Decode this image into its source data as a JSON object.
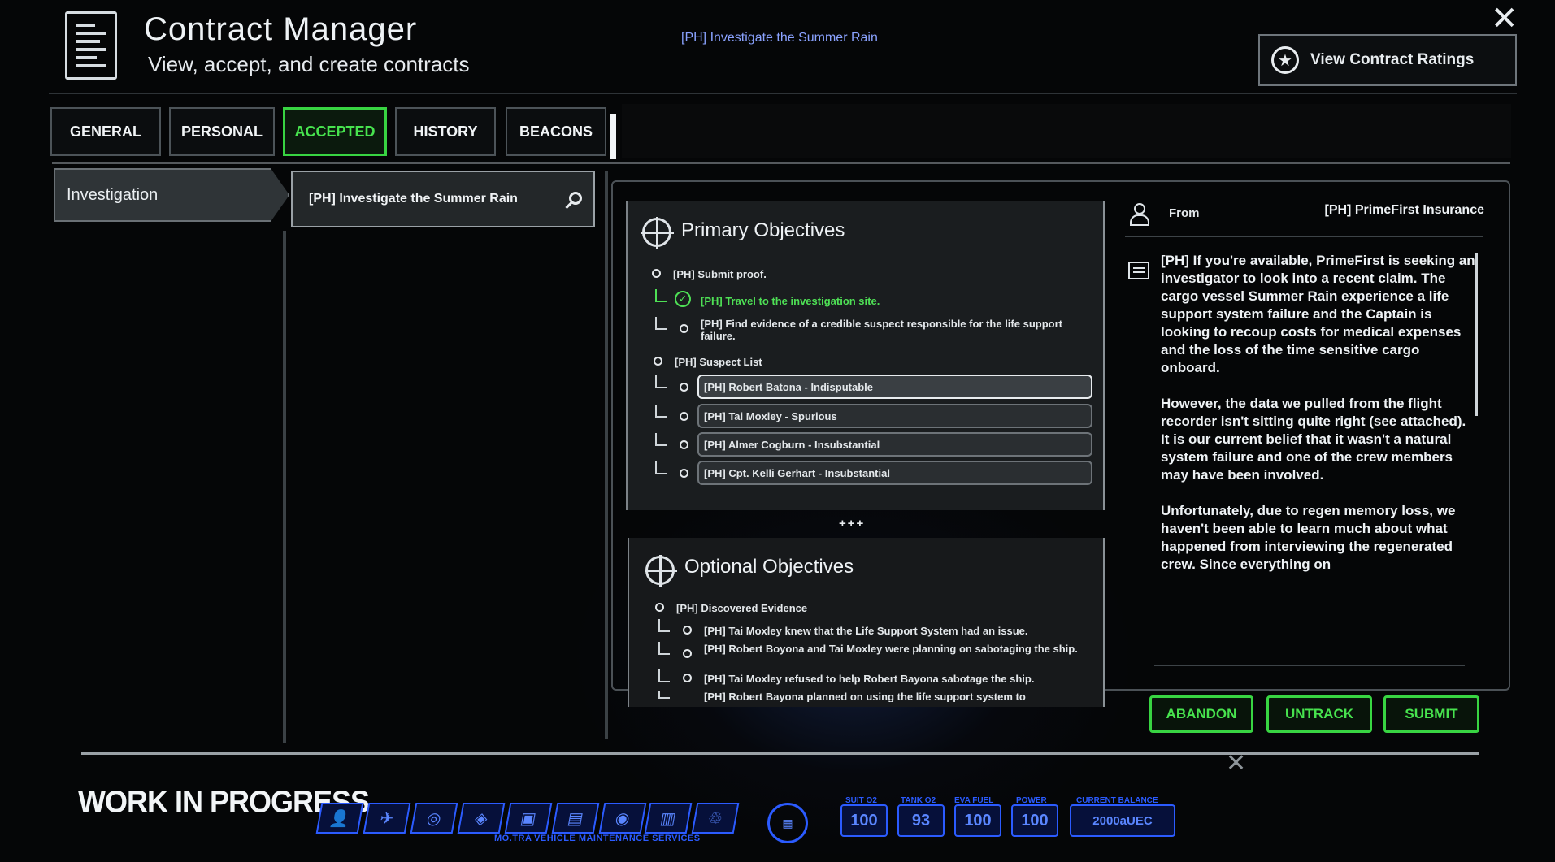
{
  "header": {
    "title": "Contract Manager",
    "subtitle": "View, accept, and create contracts",
    "tracked_contract": "[PH] Investigate the Summer Rain",
    "ratings_button": "View Contract Ratings"
  },
  "tabs": [
    {
      "label": "GENERAL",
      "active": false
    },
    {
      "label": "PERSONAL",
      "active": false
    },
    {
      "label": "ACCEPTED",
      "active": true
    },
    {
      "label": "HISTORY",
      "active": false
    },
    {
      "label": "BEACONS",
      "active": false
    }
  ],
  "categories": [
    {
      "label": "Investigation"
    }
  ],
  "contracts": [
    {
      "label": "[PH] Investigate the Summer Rain"
    }
  ],
  "primary": {
    "title": "Primary Objectives",
    "objectives": [
      {
        "text": "[PH] Submit proof.",
        "level": 0,
        "done": false
      },
      {
        "text": "[PH] Travel to the investigation site.",
        "level": 1,
        "done": true
      },
      {
        "text": "[PH] Find evidence of a credible suspect responsible for the life support failure.",
        "level": 1,
        "done": false
      },
      {
        "text": "[PH] Suspect List",
        "level": 0,
        "done": false
      }
    ],
    "suspects": [
      {
        "text": "[PH] Robert Batona - Indisputable",
        "selected": true
      },
      {
        "text": "[PH] Tai Moxley - Spurious",
        "selected": false
      },
      {
        "text": "[PH] Almer Cogburn - Insubstantial",
        "selected": false
      },
      {
        "text": "[PH] Cpt. Kelli Gerhart - Insubstantial",
        "selected": false
      }
    ],
    "more": "+++"
  },
  "optional": {
    "title": "Optional Objectives",
    "objectives": [
      {
        "text": "[PH] Discovered Evidence",
        "level": 0
      },
      {
        "text": "[PH] Tai Moxley knew that the Life Support System had an issue.",
        "level": 1
      },
      {
        "text": "[PH] Robert Boyona and Tai Moxley were planning on sabotaging the ship.",
        "level": 1
      },
      {
        "text": "[PH] Tai Moxley refused to help Robert Bayona sabotage the ship.",
        "level": 1
      },
      {
        "text": "[PH] Robert Bayona planned on using the life support system to",
        "level": 1
      }
    ]
  },
  "details": {
    "from_label": "From",
    "from_value": "[PH] PrimeFirst Insurance",
    "description": "[PH] If you're available, PrimeFirst is seeking an investigator to look into a recent claim. The cargo vessel Summer Rain experience a life support system failure and the Captain is looking to recoup costs for medical expenses and the loss of the time sensitive cargo onboard.\n\nHowever, the data we pulled from the flight recorder isn't sitting quite right (see attached). It is our current belief that it wasn't a natural system failure and one of the crew members may have been involved.\n\nUnfortunately, due to regen memory loss, we haven't been able to learn much about what happened from interviewing the regenerated crew. Since everything on"
  },
  "actions": {
    "abandon": "ABANDON",
    "untrack": "UNTRACK",
    "submit": "SUBMIT"
  },
  "footer": {
    "watermark": "WORK IN PROGRESS",
    "hud_label": "MO.TRA VEHICLE MAINTENANCE SERVICES",
    "icons": [
      "person-icon",
      "ship-icon",
      "nn-icon",
      "shield-icon",
      "cube-icon",
      "document-icon",
      "fire-icon",
      "terminal-icon",
      "recycle-icon"
    ],
    "stats": [
      {
        "label": "SUIT O2",
        "value": "100"
      },
      {
        "label": "TANK O2",
        "value": "93"
      },
      {
        "label": "EVA FUEL",
        "value": "100"
      },
      {
        "label": "POWER",
        "value": "100"
      },
      {
        "label": "CURRENT BALANCE",
        "value": "2000aUEC"
      }
    ]
  },
  "colors": {
    "accent_green": "#38d442",
    "hud_blue": "#2b5bff",
    "tracked_blue": "#8aa2ff"
  }
}
